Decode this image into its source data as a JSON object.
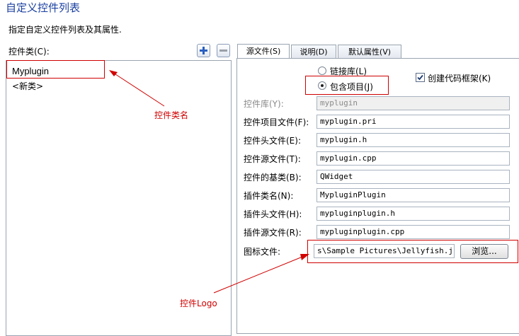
{
  "header": {
    "title": "自定义控件列表",
    "subtitle": "指定自定义控件列表及其属性."
  },
  "list": {
    "label": "控件类(C):",
    "items": [
      "Myplugin",
      "<新类>"
    ]
  },
  "tabs": [
    "源文件(S)",
    "说明(D)",
    "默认属性(V)"
  ],
  "options": {
    "link_library": "链接库(L)",
    "include_project": "包含项目(J)",
    "create_code_framework": "创建代码框架(K)"
  },
  "fields": [
    {
      "label": "控件库(Y):",
      "value": "myplugin"
    },
    {
      "label": "控件项目文件(F):",
      "value": "myplugin.pri"
    },
    {
      "label": "控件头文件(E):",
      "value": "myplugin.h"
    },
    {
      "label": "控件源文件(T):",
      "value": "myplugin.cpp"
    },
    {
      "label": "控件的基类(B):",
      "value": "QWidget"
    },
    {
      "label": "插件类名(N):",
      "value": "MypluginPlugin"
    },
    {
      "label": "插件头文件(H):",
      "value": "mypluginplugin.h"
    },
    {
      "label": "插件源文件(R):",
      "value": "mypluginplugin.cpp"
    }
  ],
  "icon_file": {
    "label": "图标文件:",
    "value": "s\\Sample Pictures\\Jellyfish.jpg",
    "browse_label": "浏览..."
  },
  "annotations": {
    "class_name": "控件类名",
    "logo": "控件Logo"
  },
  "colors": {
    "title": "#1a3fa0",
    "annotation": "#d00000",
    "border": "#9aa4b0"
  }
}
